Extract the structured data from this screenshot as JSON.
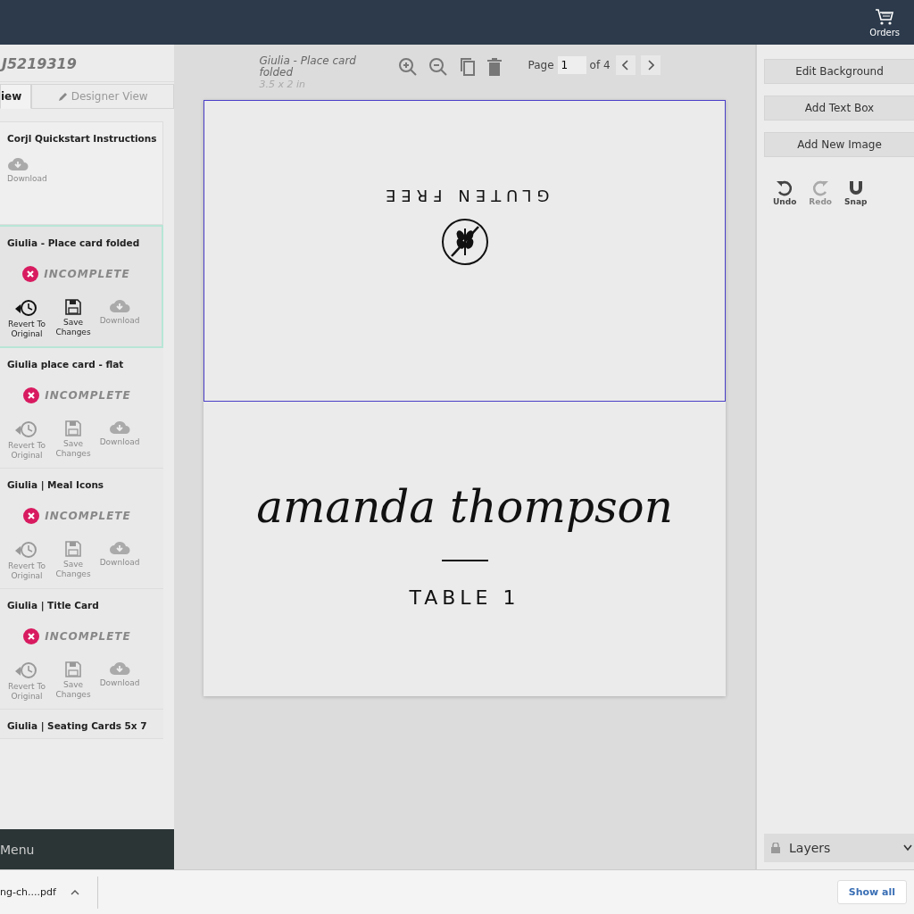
{
  "top_bar": {
    "orders_label": "Orders"
  },
  "left_panel": {
    "order_id": "J5219319",
    "tabs": [
      {
        "label": "iew",
        "selected": true
      },
      {
        "label": "Designer View",
        "selected": false
      }
    ],
    "items": [
      {
        "kind": "info",
        "title": "Corjl Quickstart Instructions",
        "selected": false,
        "actions": [
          {
            "kind": "download",
            "label": "Download",
            "enabled": false
          }
        ]
      },
      {
        "kind": "template",
        "title": "Giulia - Place card folded",
        "selected": true,
        "status": "INCOMPLETE",
        "actions": [
          {
            "kind": "revert",
            "label": "Revert To Original",
            "enabled": true
          },
          {
            "kind": "save",
            "label": "Save Changes",
            "enabled": true
          },
          {
            "kind": "download",
            "label": "Download",
            "enabled": false
          }
        ]
      },
      {
        "kind": "template",
        "title": "Giulia place card - flat",
        "selected": false,
        "status": "INCOMPLETE",
        "actions": [
          {
            "kind": "revert",
            "label": "Revert To Original",
            "enabled": false
          },
          {
            "kind": "save",
            "label": "Save Changes",
            "enabled": false
          },
          {
            "kind": "download",
            "label": "Download",
            "enabled": false
          }
        ]
      },
      {
        "kind": "template",
        "title": "Giulia | Meal Icons",
        "selected": false,
        "status": "INCOMPLETE",
        "actions": [
          {
            "kind": "revert",
            "label": "Revert To Original",
            "enabled": false
          },
          {
            "kind": "save",
            "label": "Save Changes",
            "enabled": false
          },
          {
            "kind": "download",
            "label": "Download",
            "enabled": false
          }
        ]
      },
      {
        "kind": "template",
        "title": "Giulia | Title Card",
        "selected": false,
        "status": "INCOMPLETE",
        "actions": [
          {
            "kind": "revert",
            "label": "Revert To Original",
            "enabled": false
          },
          {
            "kind": "save",
            "label": "Save Changes",
            "enabled": false
          },
          {
            "kind": "download",
            "label": "Download",
            "enabled": false
          }
        ]
      },
      {
        "kind": "template",
        "title": "Giulia | Seating Cards 5x 7",
        "selected": false
      }
    ],
    "menu_label": "Menu"
  },
  "toolbar": {
    "doc_title": "Giulia - Place card folded",
    "doc_size": "3.5 x 2 in",
    "page_label": "Page",
    "page_value": "1",
    "page_total": "of 4"
  },
  "card": {
    "top_text": "GLUTEN FREE",
    "top_selected": true,
    "name": "amanda thompson",
    "table": "TABLE 1"
  },
  "right_panel": {
    "buttons": [
      "Edit Background",
      "Add Text Box",
      "Add New Image"
    ],
    "tools": [
      {
        "kind": "undo",
        "label": "Undo",
        "enabled": true
      },
      {
        "kind": "redo",
        "label": "Redo",
        "enabled": false
      },
      {
        "kind": "snap",
        "label": "Snap",
        "enabled": true
      }
    ],
    "layers_label": "Layers"
  },
  "download_bar": {
    "file": "ng-ch....pdf",
    "show_all": "Show all"
  }
}
